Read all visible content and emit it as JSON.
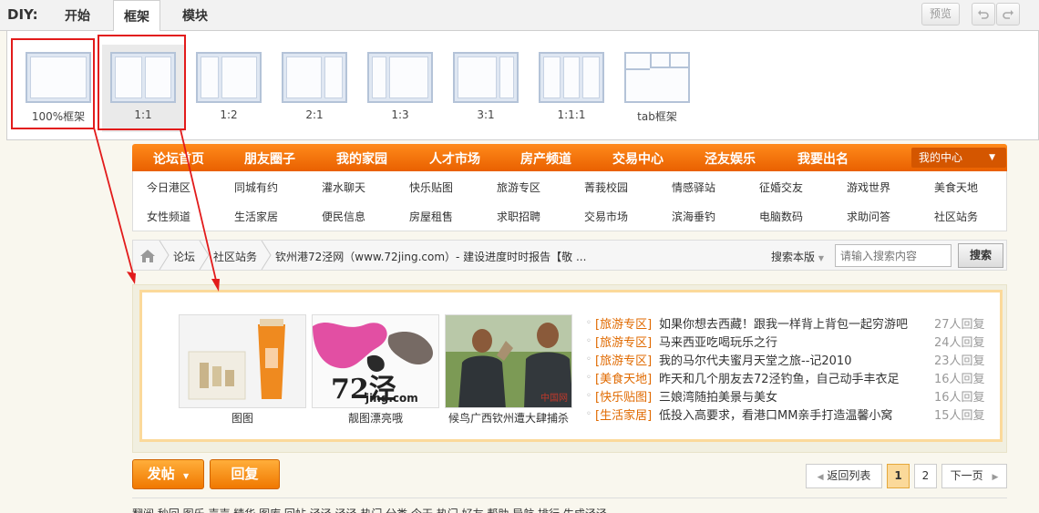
{
  "diy": {
    "label": "DIY:",
    "tabs": [
      {
        "label": "开始"
      },
      {
        "label": "框架"
      },
      {
        "label": "模块"
      }
    ],
    "preview_label": "预览",
    "undo_icon": "undo-icon",
    "redo_icon": "redo-icon"
  },
  "layouts": [
    {
      "name": "100%框架",
      "columns": [
        1
      ]
    },
    {
      "name": "1:1",
      "columns": [
        1,
        1
      ]
    },
    {
      "name": "1:2",
      "columns": [
        1,
        2
      ]
    },
    {
      "name": "2:1",
      "columns": [
        2,
        1
      ]
    },
    {
      "name": "1:3",
      "columns": [
        1,
        3
      ]
    },
    {
      "name": "3:1",
      "columns": [
        3,
        1
      ]
    },
    {
      "name": "1:1:1",
      "columns": [
        1,
        1,
        1
      ]
    },
    {
      "name": "tab框架",
      "columns": []
    }
  ],
  "nav": {
    "main": [
      "论坛首页",
      "朋友圈子",
      "我的家园",
      "人才市场",
      "房产频道",
      "交易中心",
      "泾友娱乐",
      "我要出名"
    ],
    "my_center": "我的中心",
    "sub_row1": [
      "今日港区",
      "同城有约",
      "灌水聊天",
      "快乐贴图",
      "旅游专区",
      "菁莪校园",
      "情感驿站",
      "征婚交友",
      "游戏世界",
      "美食天地"
    ],
    "sub_row2": [
      "女性频道",
      "生活家居",
      "便民信息",
      "房屋租售",
      "求职招聘",
      "交易市场",
      "滨海垂钓",
      "电脑数码",
      "求助问答",
      "社区站务"
    ]
  },
  "breadcrumb": {
    "items": [
      "论坛",
      "社区站务",
      "钦州港72泾网（www.72jing.com）- 建设进度时时报告【敬 ..."
    ],
    "search_scope": "搜索本版",
    "search_placeholder": "请输入搜索内容",
    "search_button": "搜索"
  },
  "block": {
    "images": [
      {
        "caption": "图图"
      },
      {
        "caption": "靓图漂亮哦",
        "watermark": "72泾",
        "watermark_sub": "jing.com"
      },
      {
        "caption": "候鸟广西钦州遭大肆捕杀",
        "watermark": "中国网"
      }
    ],
    "news": [
      {
        "category": "[旅游专区]",
        "title": "如果你想去西藏！跟我一样背上背包一起穷游吧",
        "replies": "27人回复"
      },
      {
        "category": "[旅游专区]",
        "title": "马来西亚吃喝玩乐之行",
        "replies": "24人回复"
      },
      {
        "category": "[旅游专区]",
        "title": "我的马尔代夫蜜月天堂之旅--记2010",
        "replies": "23人回复"
      },
      {
        "category": "[美食天地]",
        "title": "昨天和几个朋友去72泾钓鱼，自己动手丰衣足",
        "replies": "16人回复"
      },
      {
        "category": "[快乐贴图]",
        "title": "三娘湾随拍美景与美女",
        "replies": "16人回复"
      },
      {
        "category": "[生活家居]",
        "title": "低投入高要求，看港口MM亲手打造温馨小窝",
        "replies": "15人回复"
      }
    ]
  },
  "actions": {
    "post": "发帖",
    "reply": "回复",
    "back_list": "返回列表",
    "pages": [
      "1",
      "2"
    ],
    "next": "下一页"
  },
  "bottom_strip": "翻阅 秒回 图乐 声声 精华 图库 回帖 泾泾 泾泾 热门 分类 今天 热门 好友 帮助 导航 排行 生成泾泾"
}
